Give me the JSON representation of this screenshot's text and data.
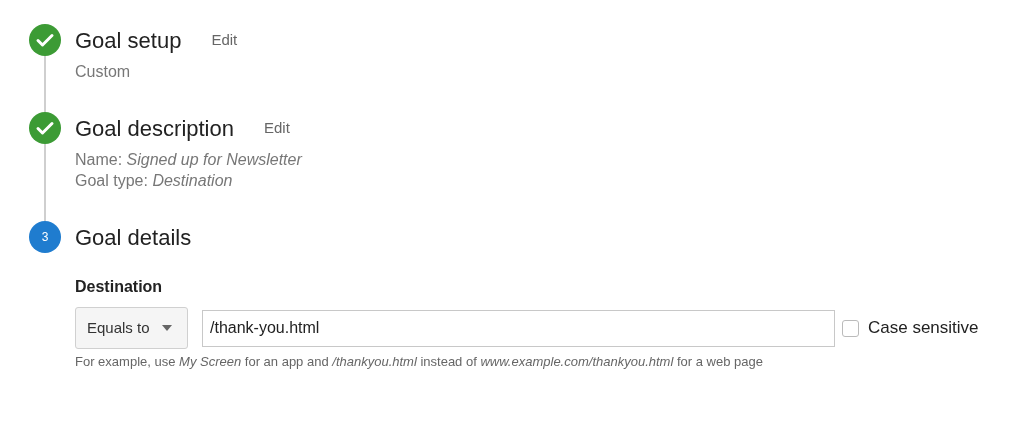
{
  "steps": [
    {
      "kind": "done",
      "title": "Goal setup",
      "edit": "Edit",
      "lines": [
        "Custom"
      ]
    },
    {
      "kind": "done",
      "title": "Goal description",
      "edit": "Edit",
      "lines": [
        "Name: *Signed up for Newsletter*",
        "Goal type: *Destination*"
      ]
    },
    {
      "kind": "current",
      "number": "3",
      "title": "Goal details"
    }
  ],
  "details": {
    "label": "Destination",
    "match": "Equals to",
    "value": "/thank-you.html",
    "case_sensitive": {
      "label": "Case sensitive",
      "checked": false
    },
    "help": "For example, use *My Screen* for an app and */thankyou.html* instead of *www.example.com/thankyou.html* for a web page"
  }
}
